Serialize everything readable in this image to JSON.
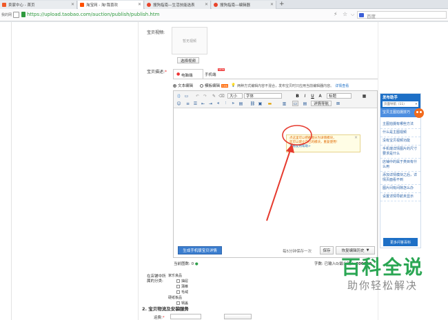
{
  "browser": {
    "tabs": [
      {
        "label": "卖家中心 - 首页",
        "active": false,
        "color": "#f05a28"
      },
      {
        "label": "淘宝网 - 淘!我喜欢",
        "active": true,
        "color": "#ff5000"
      },
      {
        "label": "搜狗指南—生活技能选表",
        "active": false,
        "color": "#e8452c"
      },
      {
        "label": "搜狗指南—编辑器",
        "active": false,
        "color": "#e8452c"
      }
    ],
    "new_tab": "+",
    "url": "https://upload.taobao.com/auction/publish/publish.htm",
    "left_stub": "我的网",
    "search_placeholder": "百度",
    "bolt": "⚡",
    "star": "☆"
  },
  "form": {
    "video_label": "宝贝视频:",
    "video_empty": "暂无视频",
    "select_video_btn": "选择视频",
    "desc_label": "宝贝描述:",
    "required_mark": "*",
    "tab_pc": "电脑端",
    "tab_mobile": "手机端",
    "tab_new_badge": "NEW",
    "radio_text": "文本编辑",
    "radio_module": "模板编辑",
    "module_badge": "new",
    "tip_text": "两种方式编辑内容不混合，发布宝贝时只应用当前编辑器内容。",
    "tip_link": "详情查看",
    "font_size_sel": "大小",
    "font_family_sel": "字体",
    "heading_sel": "标题",
    "detail_nav_btn": "详情导航",
    "tooltip_lines": [
      "点这里可以把截图分为详情模块，",
      "您可以建立自己的模块，重复使用！",
      "查看使用帮助>"
    ],
    "gen_mobile_btn": "生成手机版宝贝详情",
    "autosave_text": "每5分钟保存一次",
    "save_btn": "保存",
    "restore_btn": "恢复编辑历史",
    "image_count": "当前图数: 0",
    "text_count_label": "字数: 已输入0/最少输入",
    "text_count_max": "200000",
    "store_cat_label": "在店铺中所属的分类:",
    "categories": [
      {
        "group": "家乐良品",
        "items": [
          "抽屉",
          "蒲帷",
          "毛绒"
        ]
      },
      {
        "group": "硬纸板品",
        "items": [
          "锅盖",
          "叉勺"
        ]
      }
    ],
    "section_2": "2. 宝贝物流及安装服务",
    "freight_label": "运费:"
  },
  "help_panel": {
    "title": "发布助手",
    "nav_sel": "页面导航（11）",
    "active_item": "宝贝主图拍摄技巧",
    "items": [
      "主图拍摄有哪些方法",
      "什么是主图视频",
      "没有宝贝视频功能",
      "手机端详情图片的尺寸要求是什么",
      "店铺中的属于类目有什么用",
      "添加详情模块之后，详情页面看不到",
      "图片间有间隙怎么办",
      "设置详情导航未显示"
    ],
    "more_btn": "更多问答百科"
  },
  "watermark": {
    "main": "百科全说",
    "sub": "助你轻松解决"
  },
  "colors": {
    "accent_blue": "#1d6fc6",
    "orange": "#ff6600",
    "red": "#e33"
  }
}
